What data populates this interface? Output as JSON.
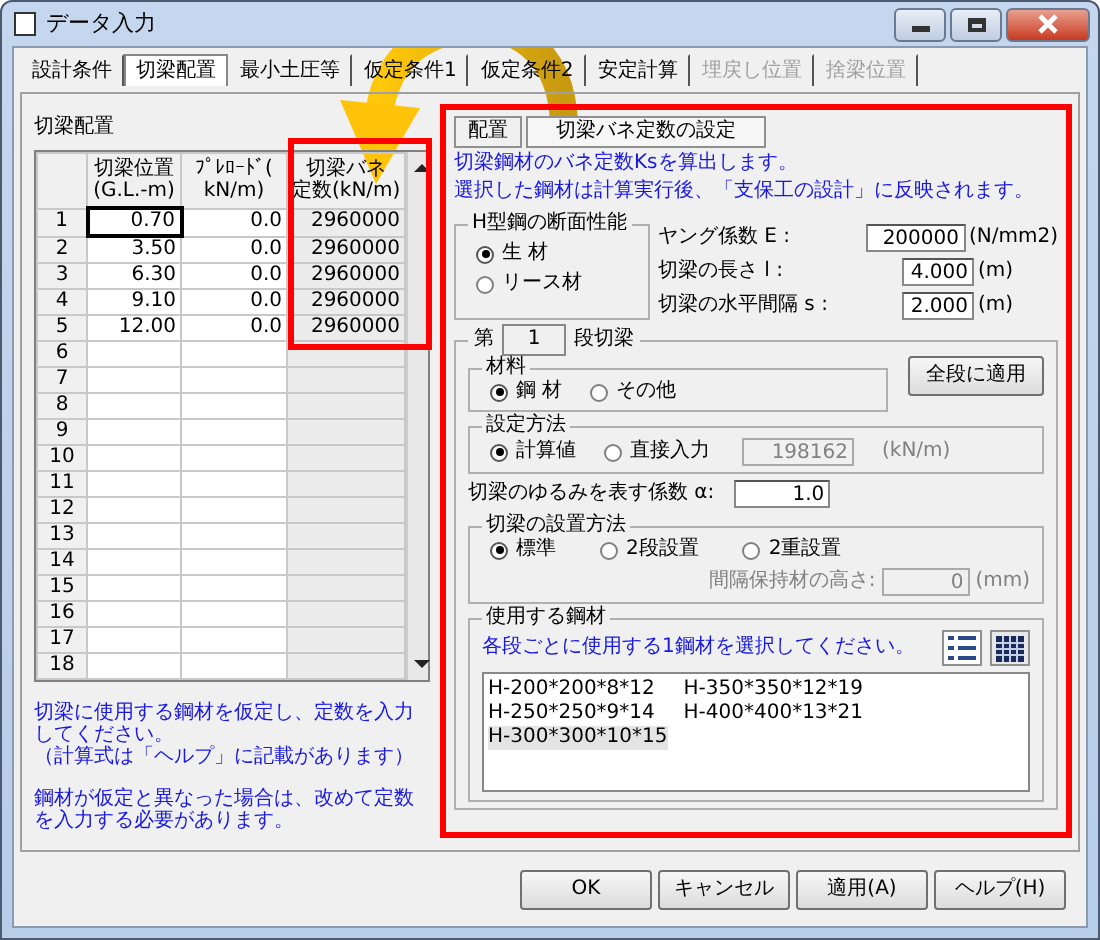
{
  "window": {
    "title": "データ入力"
  },
  "tabs": [
    {
      "label": "設計条件",
      "selected": false,
      "disabled": false
    },
    {
      "label": "切梁配置",
      "selected": true,
      "disabled": false
    },
    {
      "label": "最小土圧等",
      "selected": false,
      "disabled": false
    },
    {
      "label": "仮定条件1",
      "selected": false,
      "disabled": false
    },
    {
      "label": "仮定条件2",
      "selected": false,
      "disabled": false
    },
    {
      "label": "安定計算",
      "selected": false,
      "disabled": false
    },
    {
      "label": "埋戻し位置",
      "selected": false,
      "disabled": true
    },
    {
      "label": "捨梁位置",
      "selected": false,
      "disabled": true
    }
  ],
  "left": {
    "title": "切梁配置",
    "columns": [
      {
        "lines": [
          "切梁位置",
          "(G.L.-m)"
        ]
      },
      {
        "lines": [
          "ﾌﾟﾚﾛｰﾄﾞ(",
          "kN/m)"
        ]
      },
      {
        "lines": [
          "切梁バネ",
          "定数(kN/m)"
        ]
      }
    ],
    "rows": [
      {
        "number": "1",
        "cells": [
          "0.70",
          "0.0",
          "2960000"
        ],
        "selected": true
      },
      {
        "number": "2",
        "cells": [
          "3.50",
          "0.0",
          "2960000"
        ],
        "selected": false
      },
      {
        "number": "3",
        "cells": [
          "6.30",
          "0.0",
          "2960000"
        ],
        "selected": false
      },
      {
        "number": "4",
        "cells": [
          "9.10",
          "0.0",
          "2960000"
        ],
        "selected": false
      },
      {
        "number": "5",
        "cells": [
          "12.00",
          "0.0",
          "2960000"
        ],
        "selected": false
      },
      {
        "number": "6",
        "selected": false
      },
      {
        "number": "7",
        "selected": false
      },
      {
        "number": "8",
        "selected": false
      },
      {
        "number": "9",
        "selected": false
      },
      {
        "number": "10",
        "selected": false
      },
      {
        "number": "11",
        "selected": false
      },
      {
        "number": "12",
        "selected": false
      },
      {
        "number": "13",
        "selected": false
      },
      {
        "number": "14",
        "selected": false
      },
      {
        "number": "15",
        "selected": false
      },
      {
        "number": "16",
        "selected": false
      },
      {
        "number": "17",
        "selected": false
      },
      {
        "number": "18",
        "selected": false
      }
    ],
    "notes": [
      [
        "切梁に使用する鋼材を仮定し、定数を入力してください。",
        "（計算式は「ヘルプ」に記載があります）"
      ],
      [
        "鋼材が仮定と異なった場合は、改めて定数を入力する必要があります。"
      ]
    ]
  },
  "right": {
    "subtabs": [
      {
        "label": "配置",
        "selected": false
      },
      {
        "label": "切梁バネ定数の設定",
        "selected": true
      }
    ],
    "intro": [
      "切梁鋼材のバネ定数Ksを算出します。",
      "選択した鋼材は計算実行後、「支保工の設計」に反映されます。"
    ],
    "section": {
      "title": "H型鋼の断面性能",
      "options": [
        {
          "label": "生 材",
          "selected": true
        },
        {
          "label": "リース材",
          "selected": false
        }
      ]
    },
    "fields": [
      {
        "label": "ヤング係数 E :",
        "value": "200000",
        "unit": "(N/mm2)"
      },
      {
        "label": "切梁の長さ l :",
        "value": "4.000",
        "unit": "(m)"
      },
      {
        "label": "切梁の水平間隔 s :",
        "value": "2.000",
        "unit": "(m)"
      }
    ],
    "stage": {
      "prefix": "第",
      "value": "1",
      "suffix": "段切梁"
    },
    "apply_all_button": "全段に適用",
    "material": {
      "title": "材料",
      "options": [
        {
          "label": "鋼 材",
          "selected": true
        },
        {
          "label": "その他",
          "selected": false
        }
      ]
    },
    "method": {
      "title": "設定方法",
      "options": [
        {
          "label": "計算値",
          "selected": true
        },
        {
          "label": "直接入力",
          "selected": false
        }
      ],
      "value": "198162",
      "unit": "(kN/m)",
      "disabled": true
    },
    "alpha": {
      "label": "切梁のゆるみを表す係数 α:",
      "value": "1.0"
    },
    "install": {
      "title": "切梁の設置方法",
      "options": [
        {
          "label": "標準",
          "selected": true
        },
        {
          "label": "2段設置",
          "selected": false
        },
        {
          "label": "2重設置",
          "selected": false
        }
      ],
      "spacer_label": "間隔保持材の高さ:",
      "spacer_value": "0",
      "spacer_unit": "(mm)",
      "spacer_disabled": true
    },
    "steel": {
      "title": "使用する鋼材",
      "hint": "各段ごとに使用する1鋼材を選択してください。",
      "items": [
        {
          "label": "H-200*200*8*12",
          "selected": false
        },
        {
          "label": "H-250*250*9*14",
          "selected": false
        },
        {
          "label": "H-300*300*10*15",
          "selected": true
        },
        {
          "label": "H-350*350*12*19",
          "selected": false
        },
        {
          "label": "H-400*400*13*21",
          "selected": false
        }
      ]
    }
  },
  "buttons": [
    "OK",
    "キャンセル",
    "適用(A)",
    "ヘルプ(H)"
  ]
}
